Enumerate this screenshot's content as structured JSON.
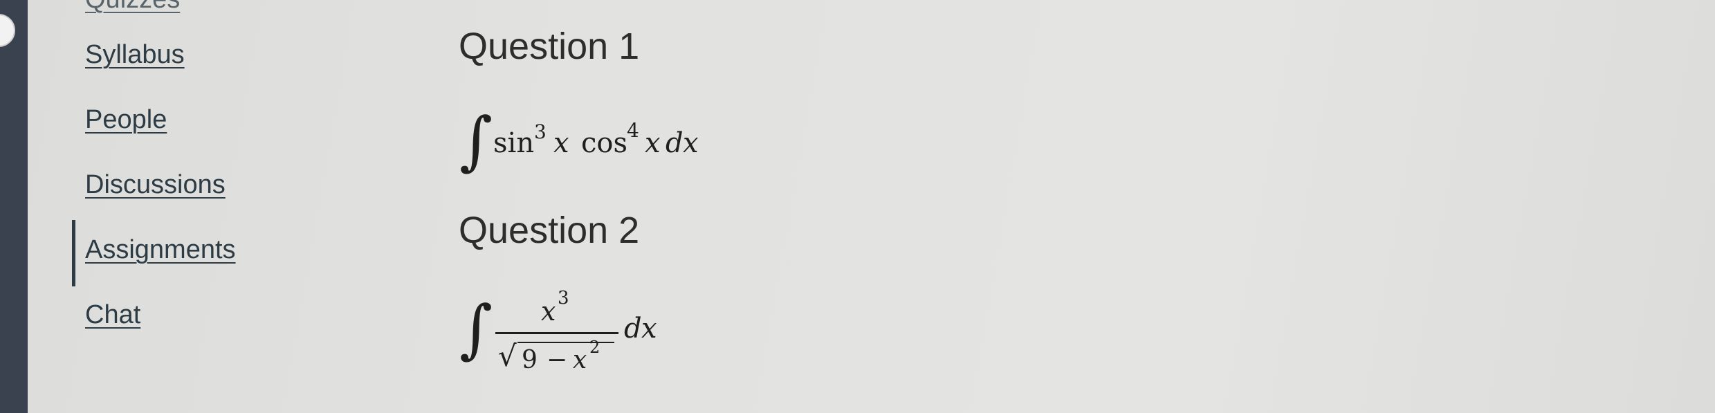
{
  "sidebar": {
    "items": [
      {
        "label": "Quizzes",
        "active": false
      },
      {
        "label": "Syllabus",
        "active": false
      },
      {
        "label": "People",
        "active": false
      },
      {
        "label": "Discussions",
        "active": false
      },
      {
        "label": "Assignments",
        "active": true
      },
      {
        "label": "Chat",
        "active": false
      }
    ]
  },
  "questions": [
    {
      "title": "Question 1",
      "expression": {
        "integral": "∫",
        "f1": "sin",
        "e1": "3",
        "v1": "x",
        "f2": "cos",
        "e2": "4",
        "v2": "x",
        "d": "d",
        "v3": "x"
      }
    },
    {
      "title": "Question 2",
      "expression": {
        "integral": "∫",
        "num_var": "x",
        "num_exp": "3",
        "root_sign": "√",
        "den_const": "9",
        "den_op": "−",
        "den_var": "x",
        "den_exp": "2",
        "d": "d",
        "v": "x"
      }
    }
  ],
  "colors": {
    "background": "#e2e2e0",
    "left_rail": "#3a4250",
    "link": "#2d3b45",
    "text": "#2d2d2d"
  }
}
